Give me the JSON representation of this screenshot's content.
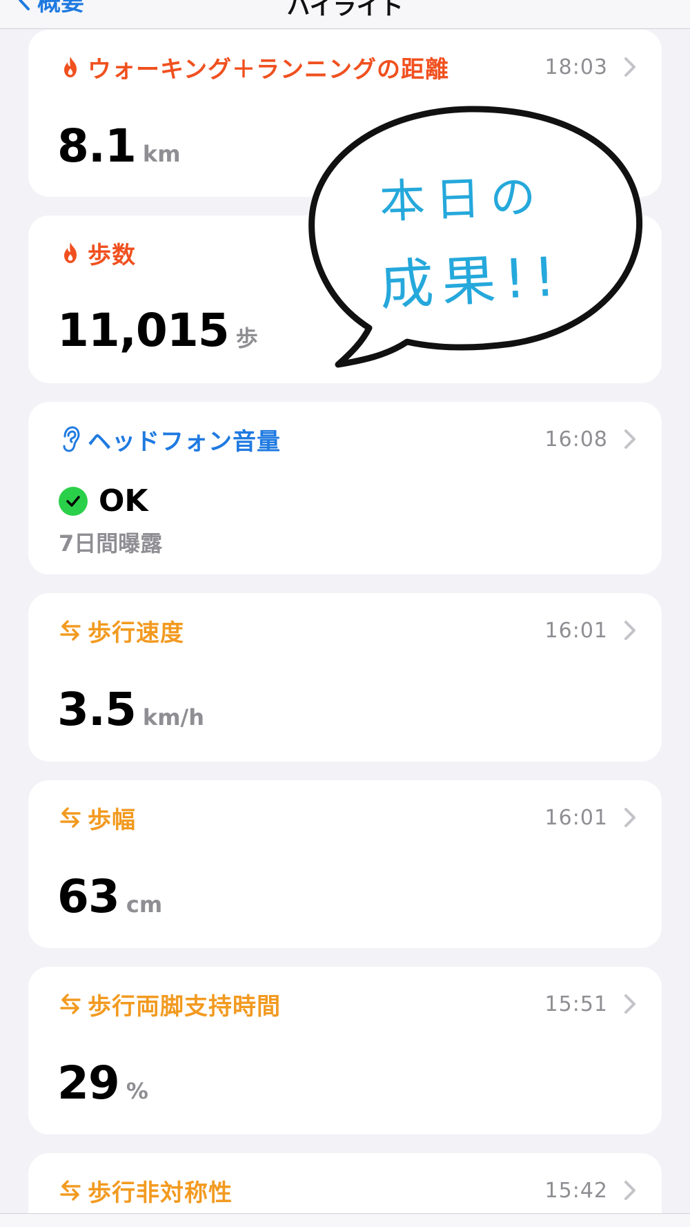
{
  "nav": {
    "back_label": "概要",
    "title": "ハイライト"
  },
  "cards": [
    {
      "title": "ウォーキング＋ランニングの距離",
      "time": "18:03",
      "value": "8.1",
      "unit": "km"
    },
    {
      "title": "歩数",
      "time": "",
      "value": "11,015",
      "unit": "歩"
    },
    {
      "title": "ヘッドフォン音量",
      "time": "16:08",
      "status": "OK",
      "subtitle": "7日間曝露"
    },
    {
      "title": "歩行速度",
      "time": "16:01",
      "value": "3.5",
      "unit": "km/h"
    },
    {
      "title": "歩幅",
      "time": "16:01",
      "value": "63",
      "unit": "cm"
    },
    {
      "title": "歩行両脚支持時間",
      "time": "15:51",
      "value": "29",
      "unit": "%"
    },
    {
      "title": "歩行非対称性",
      "time": "15:42"
    }
  ],
  "bubble": {
    "line1": "本日の",
    "line2": "成果!!"
  },
  "colors": {
    "activity": "#f0501f",
    "hearing": "#1f7ae0",
    "mobility": "#f29a20",
    "ok_green": "#2bd04a",
    "bubble_text": "#25a8db"
  },
  "icons": {
    "activity": "flame-icon",
    "hearing": "ear-icon",
    "mobility": "arrows-left-right-icon",
    "ok": "checkmark-circle-icon",
    "disclosure": "chevron-right-icon"
  }
}
